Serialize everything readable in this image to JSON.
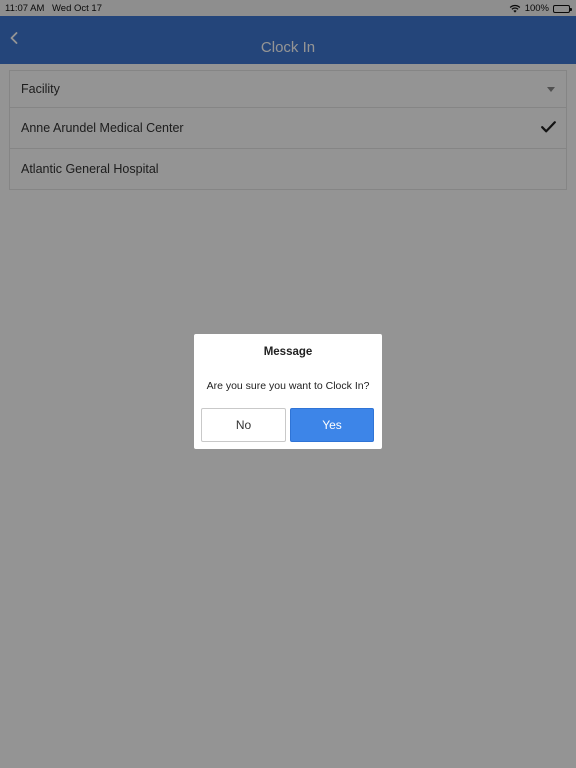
{
  "status_bar": {
    "time": "11:07 AM",
    "date": "Wed Oct 17",
    "battery": "100%"
  },
  "nav": {
    "title": "Clock In",
    "back_icon": "chevron-left-icon",
    "color": "#3f78d3"
  },
  "facility_list": {
    "header": "Facility",
    "items": [
      {
        "label": "Anne Arundel Medical Center",
        "selected": true
      },
      {
        "label": "Atlantic General Hospital",
        "selected": false
      }
    ]
  },
  "dialog": {
    "title": "Message",
    "message": "Are you sure you want to Clock In?",
    "no_label": "No",
    "yes_label": "Yes",
    "yes_color": "#3d85e8"
  }
}
